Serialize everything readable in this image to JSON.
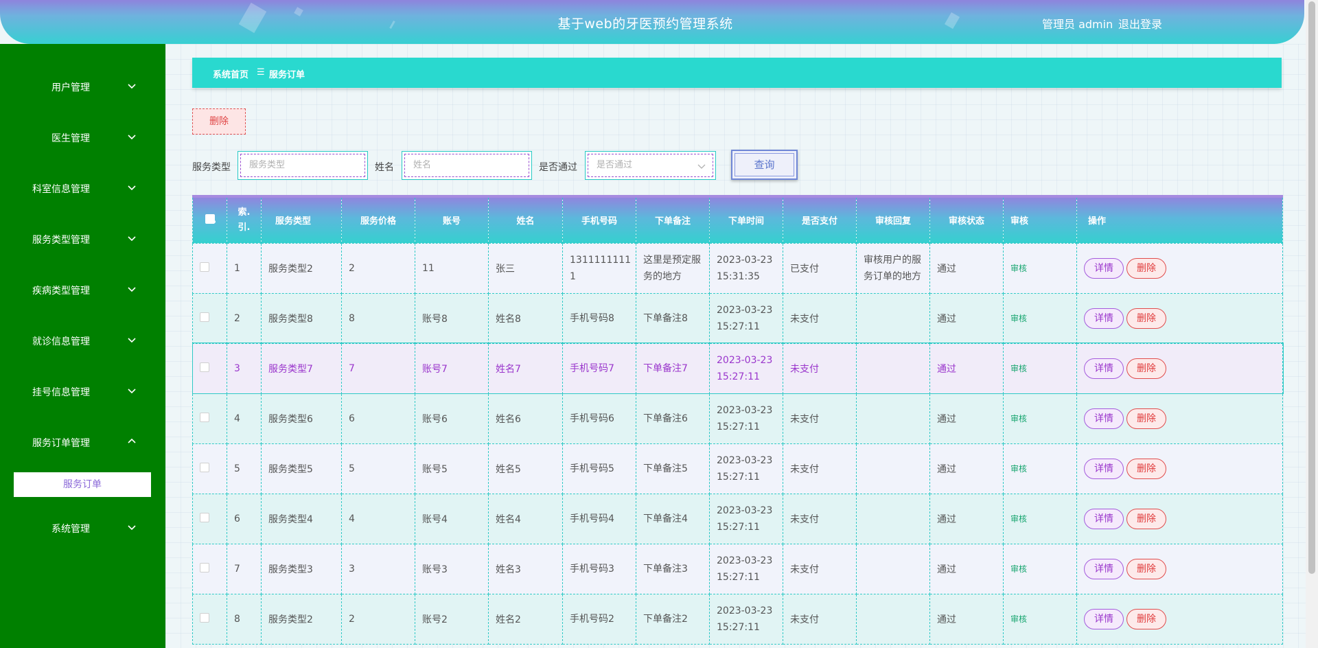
{
  "header": {
    "title": "基于web的牙医预约管理系统",
    "user_label": "管理员 admin",
    "logout_label": "退出登录"
  },
  "sidebar": {
    "items": [
      {
        "label": "用户管理",
        "expanded": false
      },
      {
        "label": "医生管理",
        "expanded": false
      },
      {
        "label": "科室信息管理",
        "expanded": false
      },
      {
        "label": "服务类型管理",
        "expanded": false
      },
      {
        "label": "疾病类型管理",
        "expanded": false
      },
      {
        "label": "就诊信息管理",
        "expanded": false
      },
      {
        "label": "挂号信息管理",
        "expanded": false
      },
      {
        "label": "服务订单管理",
        "expanded": true
      },
      {
        "label": "系统管理",
        "expanded": false
      }
    ],
    "active_sub": "服务订单"
  },
  "breadcrumb": {
    "home": "系统首页",
    "separator": "☰",
    "current": "服务订单"
  },
  "toolbar": {
    "delete_label": "删除"
  },
  "filters": {
    "service_type_label": "服务类型",
    "service_type_placeholder": "服务类型",
    "name_label": "姓名",
    "name_placeholder": "姓名",
    "passed_label": "是否通过",
    "passed_placeholder": "是否通过",
    "search_label": "查询"
  },
  "table": {
    "headers": [
      "索引",
      "服务类型",
      "服务价格",
      "账号",
      "姓名",
      "手机号码",
      "下单备注",
      "下单时间",
      "是否支付",
      "审核回复",
      "审核状态",
      "审核",
      "操作"
    ],
    "index_header_lines": [
      "索.",
      "引."
    ],
    "audit_label": "审核",
    "detail_label": "详情",
    "delete_label": "删除",
    "rows": [
      {
        "index": "1",
        "service_type": "服务类型2",
        "price": "2",
        "account": "11",
        "name": "张三",
        "phone": [
          "1311111111",
          "1"
        ],
        "remark": [
          "这里是预定服",
          "务的地方"
        ],
        "time": [
          "2023-03-23",
          "15:31:35"
        ],
        "paid": "已支付",
        "reply": [
          "审核用户的服",
          "务订单的地方"
        ],
        "status": "通过"
      },
      {
        "index": "2",
        "service_type": "服务类型8",
        "price": "8",
        "account": "账号8",
        "name": "姓名8",
        "phone": [
          "手机号码8"
        ],
        "remark": [
          "下单备注8"
        ],
        "time": [
          "2023-03-23",
          "15:27:11"
        ],
        "paid": "未支付",
        "reply": [],
        "status": "通过"
      },
      {
        "index": "3",
        "service_type": "服务类型7",
        "price": "7",
        "account": "账号7",
        "name": "姓名7",
        "phone": [
          "手机号码7"
        ],
        "remark": [
          "下单备注7"
        ],
        "time": [
          "2023-03-23",
          "15:27:11"
        ],
        "paid": "未支付",
        "reply": [],
        "status": "通过"
      },
      {
        "index": "4",
        "service_type": "服务类型6",
        "price": "6",
        "account": "账号6",
        "name": "姓名6",
        "phone": [
          "手机号码6"
        ],
        "remark": [
          "下单备注6"
        ],
        "time": [
          "2023-03-23",
          "15:27:11"
        ],
        "paid": "未支付",
        "reply": [],
        "status": "通过"
      },
      {
        "index": "5",
        "service_type": "服务类型5",
        "price": "5",
        "account": "账号5",
        "name": "姓名5",
        "phone": [
          "手机号码5"
        ],
        "remark": [
          "下单备注5"
        ],
        "time": [
          "2023-03-23",
          "15:27:11"
        ],
        "paid": "未支付",
        "reply": [],
        "status": "通过"
      },
      {
        "index": "6",
        "service_type": "服务类型4",
        "price": "4",
        "account": "账号4",
        "name": "姓名4",
        "phone": [
          "手机号码4"
        ],
        "remark": [
          "下单备注4"
        ],
        "time": [
          "2023-03-23",
          "15:27:11"
        ],
        "paid": "未支付",
        "reply": [],
        "status": "通过"
      },
      {
        "index": "7",
        "service_type": "服务类型3",
        "price": "3",
        "account": "账号3",
        "name": "姓名3",
        "phone": [
          "手机号码3"
        ],
        "remark": [
          "下单备注3"
        ],
        "time": [
          "2023-03-23",
          "15:27:11"
        ],
        "paid": "未支付",
        "reply": [],
        "status": "通过"
      },
      {
        "index": "8",
        "service_type": "服务类型2",
        "price": "2",
        "account": "账号2",
        "name": "姓名2",
        "phone": [
          "手机号码2"
        ],
        "remark": [
          "下单备注2"
        ],
        "time": [
          "2023-03-23",
          "15:27:11"
        ],
        "paid": "未支付",
        "reply": [],
        "status": "通过"
      }
    ]
  }
}
